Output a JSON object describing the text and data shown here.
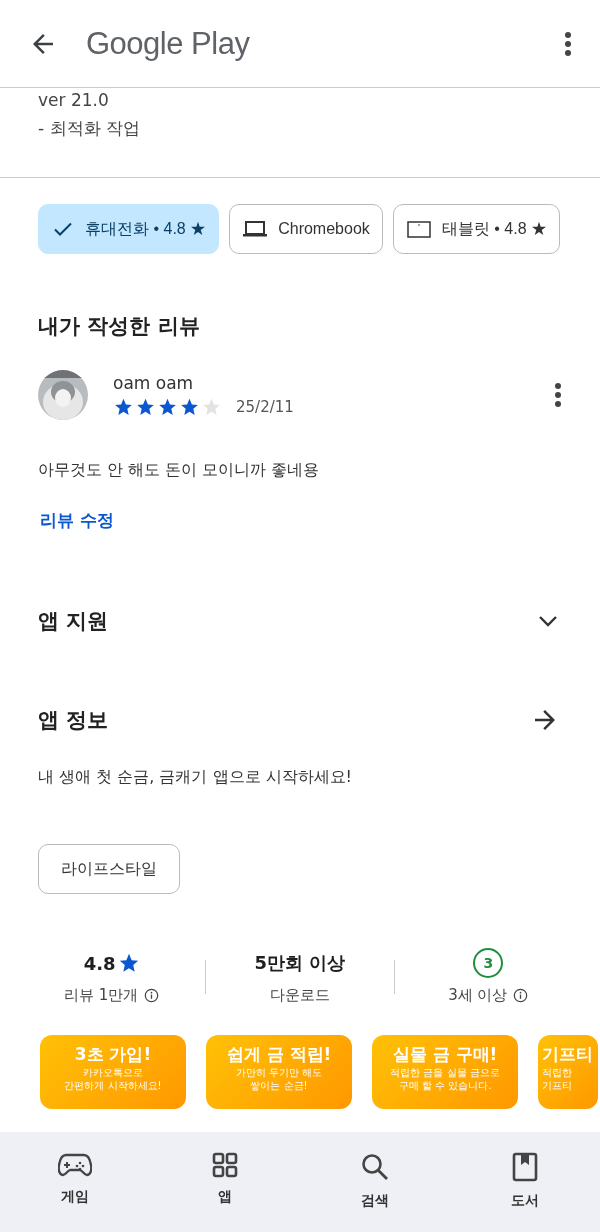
{
  "header": {
    "title": "Google Play"
  },
  "whats_new": [
    "ver 21.0",
    "- 최적화 작업"
  ],
  "device_chips": [
    {
      "label": "휴대전화 • 4.8 ★",
      "selected": true
    },
    {
      "kind": "laptop",
      "label": "Chromebook",
      "selected": false
    },
    {
      "kind": "tablet",
      "label": "태블릿 • 4.8 ★",
      "selected": false
    }
  ],
  "my_review": {
    "heading": "내가 작성한 리뷰",
    "author": "oam oam",
    "stars": 4,
    "date": "25/2/11",
    "text": "아무것도 안 해도 돈이 모이니까 좋네용",
    "edit_link": "리뷰 수정"
  },
  "sections": [
    {
      "kind": "expand",
      "title": "앱 지원"
    },
    {
      "kind": "arrow",
      "title": "앱 정보"
    }
  ],
  "app_description": "내 생애 첫 순금, 금캐기 앱으로 시작하세요!",
  "category_chip": "라이프스타일",
  "stats": [
    {
      "kind": "rating",
      "value": "4.8",
      "label": "리뷰 1만개"
    },
    {
      "kind": "plain",
      "value": "5만회 이상",
      "label": "다운로드"
    },
    {
      "kind": "age",
      "value": "3",
      "label": "3세 이상"
    }
  ],
  "screenshots": [
    {
      "title": "3초 가입!",
      "lines": [
        "카카오톡으로",
        "간편하게 시작하세요!"
      ]
    },
    {
      "title": "쉽게 금 적립!",
      "lines": [
        "가만히 두기만 해도",
        "쌓이는 순금!"
      ]
    },
    {
      "title": "실물 금 구매!",
      "lines": [
        "적립한 금을 실물 금으로",
        "구매 할 수 있습니다."
      ]
    },
    {
      "title": "기프티",
      "lines": [
        "적립한",
        "기프티"
      ]
    }
  ],
  "bottom_nav": [
    {
      "kind": "games",
      "label": "게임",
      "selected": false
    },
    {
      "kind": "apps",
      "label": "앱",
      "selected": false
    },
    {
      "kind": "search",
      "label": "검색",
      "selected": false
    },
    {
      "kind": "books",
      "label": "도서",
      "selected": false
    }
  ]
}
